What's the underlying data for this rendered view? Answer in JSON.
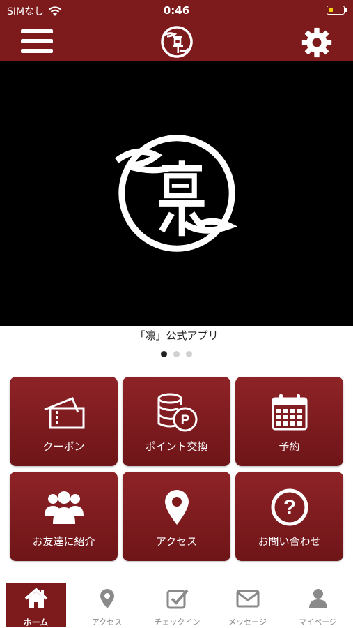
{
  "status_bar": {
    "carrier": "SIMなし",
    "time": "0:46",
    "battery_color": "#f5d20c"
  },
  "navbar": {
    "menu_icon": "hamburger-icon",
    "logo": "rin-logo",
    "settings_icon": "gear-icon",
    "bg_color": "#7d1a1c"
  },
  "hero": {
    "caption": "「凛」公式アプリ",
    "slides_total": 3,
    "active_slide": 1
  },
  "tiles": [
    {
      "icon": "ticket-icon",
      "label": "クーポン"
    },
    {
      "icon": "point-coins-icon",
      "label": "ポイント交換"
    },
    {
      "icon": "calendar-icon",
      "label": "予約"
    },
    {
      "icon": "group-icon",
      "label": "お友達に紹介"
    },
    {
      "icon": "map-pin-icon",
      "label": "アクセス"
    },
    {
      "icon": "question-icon",
      "label": "お問い合わせ"
    }
  ],
  "tabbar": [
    {
      "icon": "home-icon",
      "label": "ホーム",
      "active": true
    },
    {
      "icon": "map-pin-icon",
      "label": "アクセス",
      "active": false
    },
    {
      "icon": "checkbox-icon",
      "label": "チェックイン",
      "active": false
    },
    {
      "icon": "envelope-icon",
      "label": "メッセージ",
      "active": false
    },
    {
      "icon": "person-icon",
      "label": "マイページ",
      "active": false
    }
  ]
}
